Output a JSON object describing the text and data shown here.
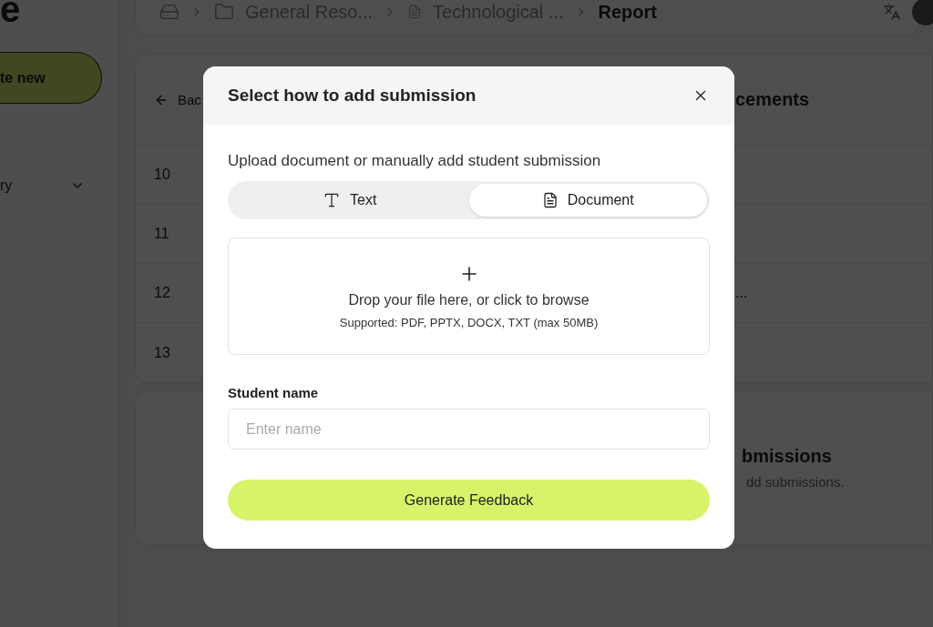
{
  "sidebar": {
    "logo": "e",
    "create_button": "te new",
    "nav_items": [
      {
        "label": "ry",
        "expanded": false
      }
    ]
  },
  "breadcrumbs": [
    {
      "label": "General Reso...",
      "kind": "folder",
      "current": false
    },
    {
      "label": "Technological ...",
      "kind": "document",
      "current": false
    },
    {
      "label": "Report",
      "kind": "page",
      "current": true
    }
  ],
  "content": {
    "back_link": "Bac",
    "heading": "cements",
    "rows": [
      {
        "number": "10"
      },
      {
        "number": "11"
      },
      {
        "number": "12",
        "tail": "..."
      },
      {
        "number": "13"
      }
    ]
  },
  "empty_state": {
    "title": "bmissions",
    "text": "dd submissions."
  },
  "modal": {
    "title": "Select how to add submission",
    "prompt": "Upload document or manually add student submission",
    "tabs": [
      {
        "label": "Text",
        "kind": "text",
        "selected": false
      },
      {
        "label": "Document",
        "kind": "document",
        "selected": true
      }
    ],
    "dropzone": {
      "text": "Drop your file here, or click to browse",
      "hint": "Supported: PDF, PPTX, DOCX, TXT (max 50MB)"
    },
    "field": {
      "label": "Student name",
      "placeholder": "Enter name"
    },
    "submit": "Generate Feedback"
  }
}
